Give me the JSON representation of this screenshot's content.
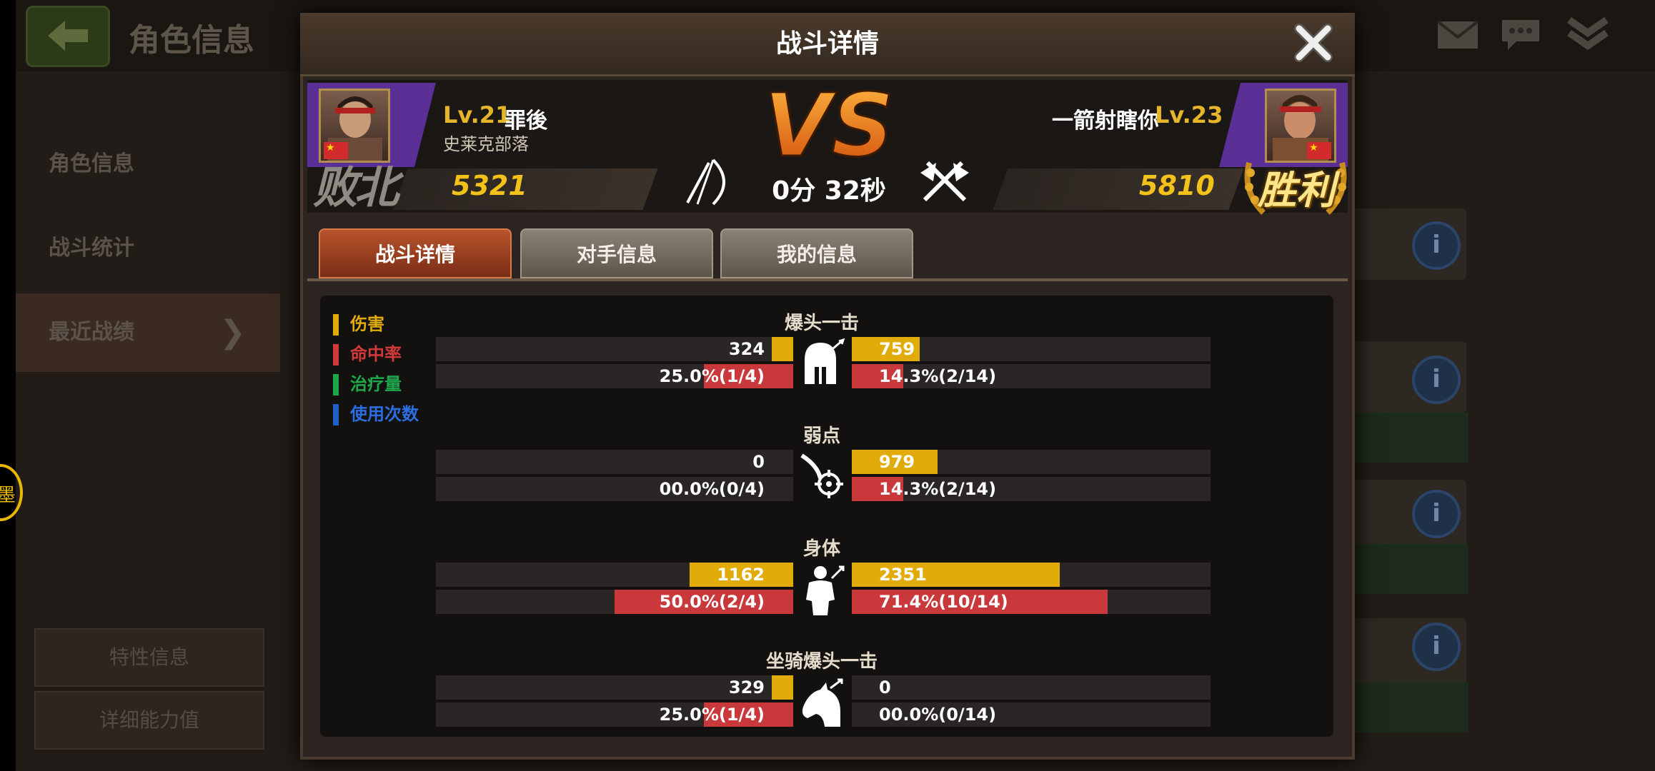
{
  "background": {
    "title": "角色信息",
    "sidebar": [
      {
        "label": "角色信息"
      },
      {
        "label": "战斗统计"
      },
      {
        "label": "最近战绩"
      }
    ],
    "buttons": {
      "traits": "特性信息",
      "abilities": "详细能力值"
    },
    "side_ring_text": "墨"
  },
  "dialog": {
    "title": "战斗详情",
    "close_icon": "close-x-icon",
    "player_left": {
      "level": "Lv.21",
      "name": "罪後",
      "guild": "史莱克部落",
      "score": "5321",
      "result": "败北"
    },
    "player_right": {
      "level": "Lv.23",
      "name": "一箭射瞎你",
      "score": "5810",
      "result": "胜利"
    },
    "vs": "VS",
    "duration": "0分 32秒",
    "tabs": [
      {
        "label": "战斗详情",
        "active": true
      },
      {
        "label": "对手信息",
        "active": false
      },
      {
        "label": "我的信息",
        "active": false
      }
    ],
    "legend": [
      {
        "label": "伤害",
        "color": "#e1ab0a"
      },
      {
        "label": "命中率",
        "color": "#d23a3a"
      },
      {
        "label": "治疗量",
        "color": "#1ea84a"
      },
      {
        "label": "使用次数",
        "color": "#1e5fc8"
      }
    ],
    "sections": [
      {
        "title": "爆头一击",
        "icon": "helmet-icon",
        "damage_left": "324",
        "damage_right": "759",
        "damage_left_frac": 0.06,
        "damage_right_frac": 0.19,
        "hit_left": "25.0%(1/4)",
        "hit_right": "14.3%(2/14)",
        "hit_left_frac": 0.25,
        "hit_right_frac": 0.143
      },
      {
        "title": "弱点",
        "icon": "weakpoint-target-icon",
        "damage_left": "0",
        "damage_right": "979",
        "damage_left_frac": 0.0,
        "damage_right_frac": 0.24,
        "hit_left": "00.0%(0/4)",
        "hit_right": "14.3%(2/14)",
        "hit_left_frac": 0.0,
        "hit_right_frac": 0.143
      },
      {
        "title": "身体",
        "icon": "body-icon",
        "damage_left": "1162",
        "damage_right": "2351",
        "damage_left_frac": 0.29,
        "damage_right_frac": 0.58,
        "hit_left": "50.0%(2/4)",
        "hit_right": "71.4%(10/14)",
        "hit_left_frac": 0.5,
        "hit_right_frac": 0.714
      },
      {
        "title": "坐骑爆头一击",
        "icon": "horse-head-icon",
        "damage_left": "329",
        "damage_right": "0",
        "damage_left_frac": 0.06,
        "damage_right_frac": 0.0,
        "hit_left": "25.0%(1/4)",
        "hit_right": "00.0%(0/14)",
        "hit_left_frac": 0.25,
        "hit_right_frac": 0.0
      }
    ]
  }
}
